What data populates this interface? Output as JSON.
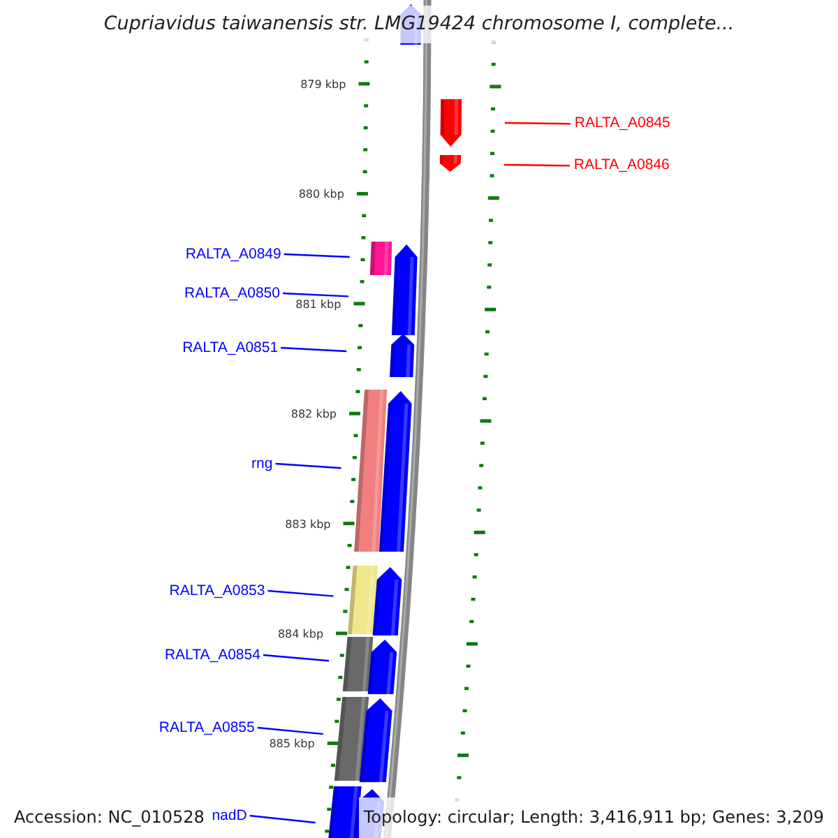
{
  "title": "Cupriavidus taiwanensis str. LMG19424 chromosome I, complete...",
  "ruler_labels": [
    "879 kbp",
    "880 kbp",
    "881 kbp",
    "882 kbp",
    "883 kbp",
    "884 kbp",
    "885 kbp"
  ],
  "cds_features": [
    {
      "kind": "reverse"
    },
    {
      "kind": "forward"
    },
    {
      "kind": "forward"
    },
    {
      "kind": "reverse"
    },
    {
      "kind": "reverse"
    },
    {
      "kind": "reverse"
    },
    {
      "kind": "reverse"
    },
    {
      "kind": "reverse"
    },
    {
      "kind": "reverse"
    },
    {
      "kind": "reverse"
    }
  ],
  "cog_features": [
    {
      "color": "#ff1493"
    },
    {
      "color": "#f08080"
    },
    {
      "color": "#f0e68c"
    },
    {
      "color": "#696969"
    },
    {
      "color": "#696969"
    },
    {
      "color": "#0000ff"
    }
  ],
  "feature_labels": [
    {
      "text": "RALTA_A0845",
      "kind": "forward"
    },
    {
      "text": "RALTA_A0846",
      "kind": "forward"
    },
    {
      "text": "RALTA_A0849",
      "kind": "reverse"
    },
    {
      "text": "RALTA_A0850",
      "kind": "reverse"
    },
    {
      "text": "RALTA_A0851",
      "kind": "reverse"
    },
    {
      "text": "rng",
      "kind": "reverse"
    },
    {
      "text": "RALTA_A0853",
      "kind": "reverse"
    },
    {
      "text": "RALTA_A0854",
      "kind": "reverse"
    },
    {
      "text": "RALTA_A0855",
      "kind": "reverse"
    },
    {
      "text": "nadD",
      "kind": "reverse"
    }
  ],
  "footer": {
    "accession": "Accession: NC_010528",
    "summary": "Topology: circular; Length: 3,416,911 bp; Genes: 3,209"
  }
}
